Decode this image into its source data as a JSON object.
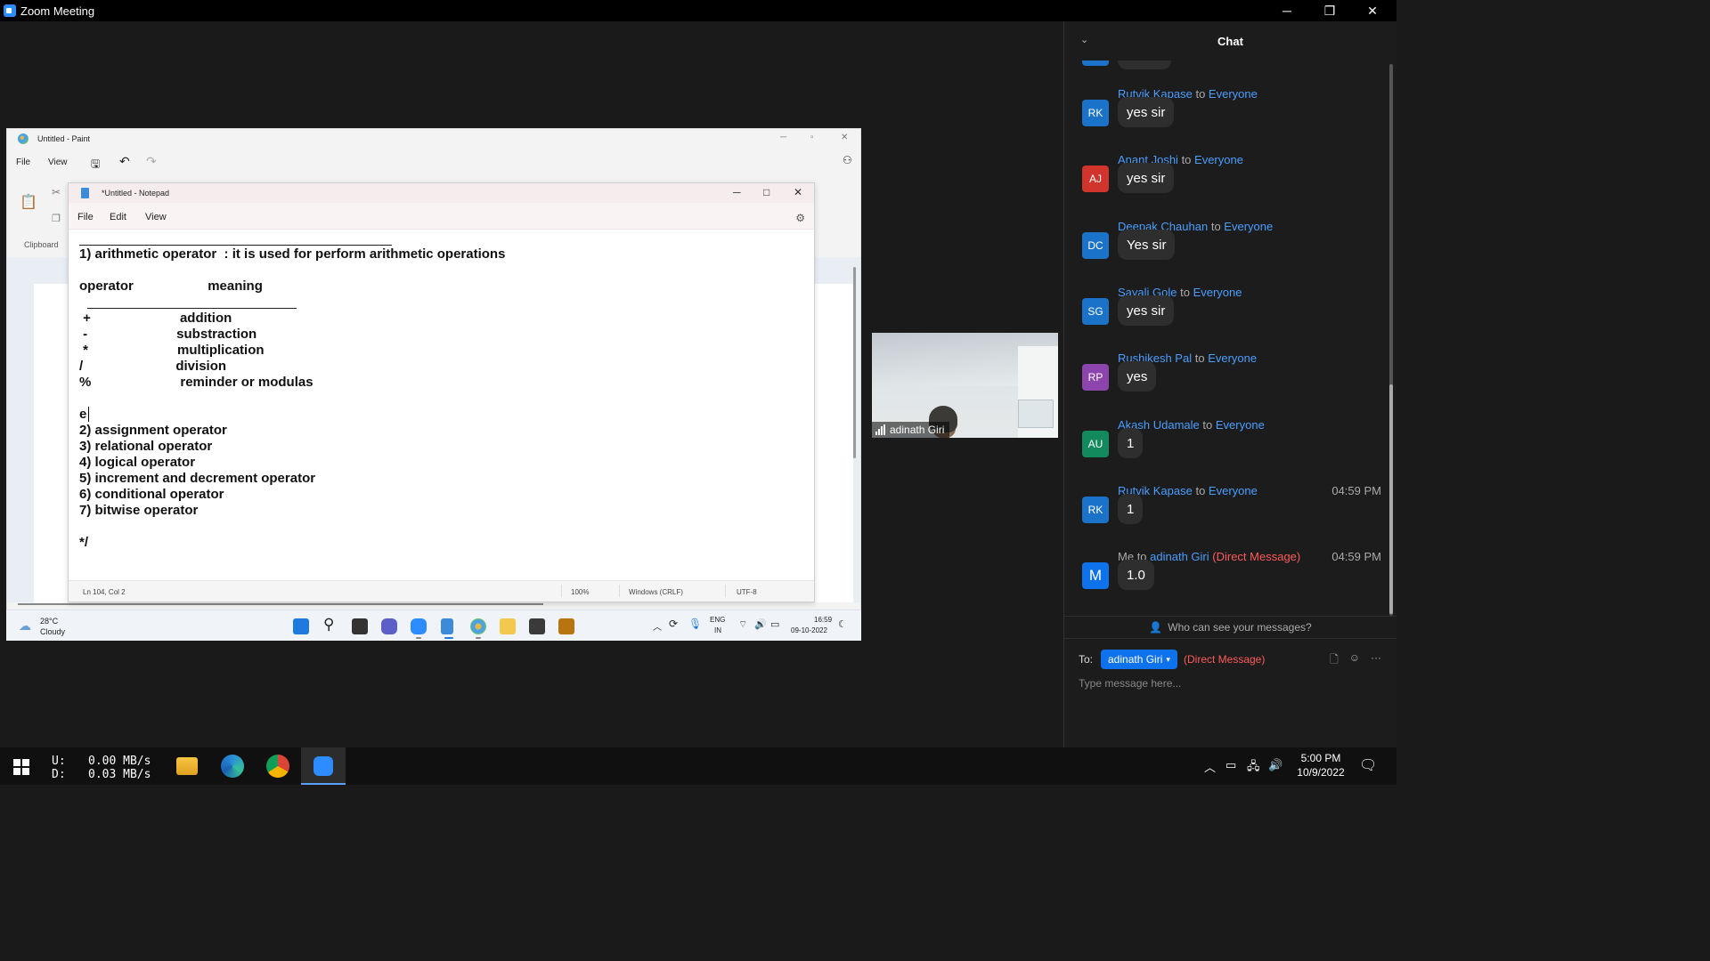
{
  "window": {
    "title": "Zoom Meeting",
    "minimize": "─",
    "maximize": "❐",
    "close": "✕"
  },
  "paint": {
    "title": "Untitled - Paint",
    "menu": [
      "File",
      "View"
    ],
    "clipboard_label": "Clipboard",
    "minimize": "─",
    "maximize": "▫",
    "close": "✕"
  },
  "notepad": {
    "title": "*Untitled - Notepad",
    "menu": [
      "File",
      "Edit",
      "View"
    ],
    "lines": [
      "1) arithmetic operator  : it is used for perform arithmetic operations",
      "operator                    meaning",
      " +                        addition",
      " -                        substraction",
      " *                        multiplication",
      "/                         division",
      "%                        reminder or modulas",
      "e",
      "2) assignment operator",
      "3) relational operator",
      "4) logical operator",
      "5) increment and decrement operator",
      "6) conditional operator",
      "7) bitwise operator",
      "*/"
    ],
    "status": {
      "position": "Ln 104, Col 2",
      "zoom": "100%",
      "line_ending": "Windows (CRLF)",
      "encoding": "UTF-8"
    }
  },
  "inner_taskbar": {
    "weather_temp": "28°C",
    "weather_desc": "Cloudy",
    "lang": "ENG",
    "region": "IN",
    "time": "16:59",
    "date": "09-10-2022"
  },
  "video": {
    "participant": "adinath Giri"
  },
  "chat": {
    "title": "Chat",
    "messages": [
      {
        "from": "Rutvik Kapase",
        "to_word": "to",
        "to": "Everyone",
        "initials": "RK",
        "color": "#1a73c8",
        "text": "yes sir",
        "time": ""
      },
      {
        "from": "Anant Joshi",
        "to_word": "to",
        "to": "Everyone",
        "initials": "AJ",
        "color": "#d0342c",
        "text": "yes sir",
        "time": ""
      },
      {
        "from": "Deepak Chauhan",
        "to_word": "to",
        "to": "Everyone",
        "initials": "DC",
        "color": "#1a73c8",
        "text": "Yes sir",
        "time": ""
      },
      {
        "from": "Sayali Gole",
        "to_word": "to",
        "to": "Everyone",
        "initials": "SG",
        "color": "#1a73c8",
        "text": "yes sir",
        "time": ""
      },
      {
        "from": "Rushikesh Pal",
        "to_word": "to",
        "to": "Everyone",
        "initials": "RP",
        "color": "#8e44ad",
        "text": "yes",
        "time": ""
      },
      {
        "from": "Akash Udamale",
        "to_word": "to",
        "to": "Everyone",
        "initials": "AU",
        "color": "#138a5e",
        "text": "1",
        "time": ""
      },
      {
        "from": "Rutvik Kapase",
        "to_word": "to",
        "to": "Everyone",
        "initials": "RK",
        "color": "#1a73c8",
        "text": "1",
        "time": "04:59 PM"
      },
      {
        "from": "Me",
        "to_word": "to",
        "to": "adinath Giri",
        "dm": "(Direct Message)",
        "initials": "M",
        "color": "#0e72ed",
        "text": "1.0",
        "time": "04:59 PM"
      }
    ],
    "who_can_see": "Who can see your messages?",
    "to_label": "To:",
    "recipient": "adinath Giri",
    "recipient_dm": "(Direct Message)",
    "placeholder": "Type message here..."
  },
  "taskbar": {
    "upload_label": "U:",
    "download_label": "D:",
    "upload_speed": "0.00 MB/s",
    "download_speed": "0.03 MB/s",
    "time": "5:00 PM",
    "date": "10/9/2022"
  }
}
